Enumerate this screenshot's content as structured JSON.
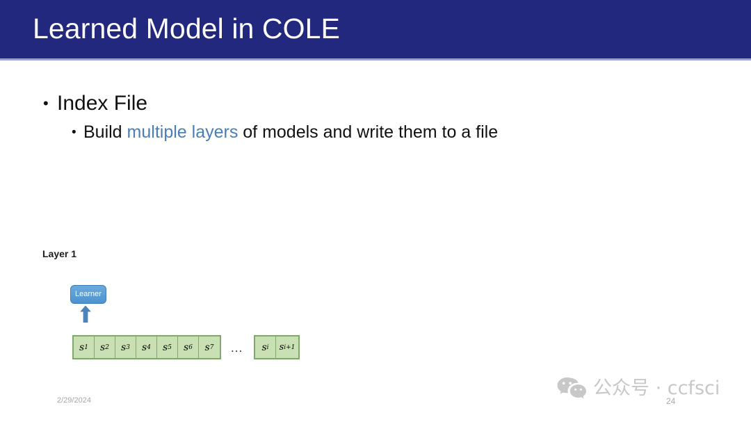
{
  "slide": {
    "title": "Learned Model in COLE",
    "accent_banner_color": "#23287f",
    "banner_underline_color": "#9aa0cf",
    "highlight_color": "#4a7ebb"
  },
  "content": {
    "bullet_marker": "•",
    "level1": {
      "text": "Index File"
    },
    "level2": {
      "prefix": "Build ",
      "highlight": "multiple layers",
      "suffix": " of models and write them to a file"
    }
  },
  "diagram": {
    "layer_label": "Layer 1",
    "learner_label": "Learner",
    "learner_fill": "#4e93ce",
    "arrow_color": "#4e85b8",
    "segment_fill": "#c9dfb4",
    "segment_border": "#7fa86a",
    "ellipsis": "...",
    "segments_left": [
      {
        "base": "s",
        "sub": "1"
      },
      {
        "base": "s",
        "sub": "2"
      },
      {
        "base": "s",
        "sub": "3"
      },
      {
        "base": "s",
        "sub": "4"
      },
      {
        "base": "s",
        "sub": "5"
      },
      {
        "base": "s",
        "sub": "6"
      },
      {
        "base": "s",
        "sub": "7"
      }
    ],
    "segments_right": [
      {
        "base": "s",
        "sub": "i"
      },
      {
        "base": "s",
        "sub": "i+1"
      }
    ]
  },
  "footer": {
    "date": "2/29/2024",
    "page_number": "24"
  },
  "watermark": {
    "text": "公众号 · ccfsci",
    "color": "#c8c8c8"
  }
}
